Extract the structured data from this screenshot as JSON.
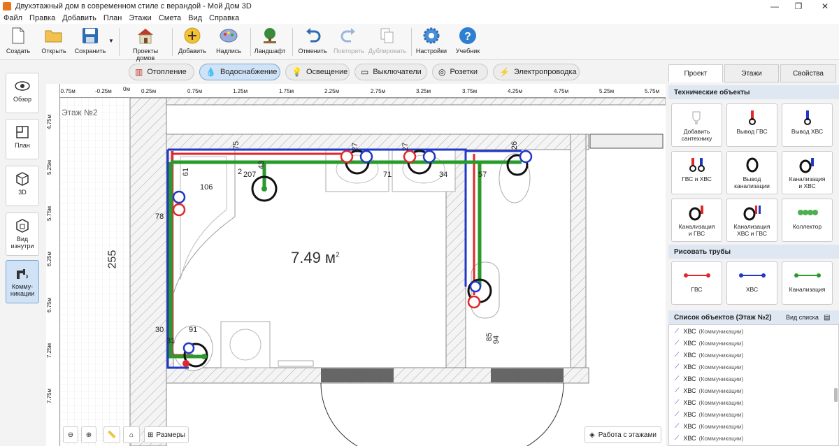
{
  "window": {
    "title": "Двухэтажный дом в современном стиле с верандой - Мой Дом 3D"
  },
  "menu": [
    "Файл",
    "Правка",
    "Добавить",
    "План",
    "Этажи",
    "Смета",
    "Вид",
    "Справка"
  ],
  "toolbar": {
    "create": "Создать",
    "open": "Открыть",
    "save": "Сохранить",
    "projects": "Проекты домов",
    "add": "Добавить",
    "label": "Надпись",
    "landscape": "Ландшафт",
    "undo": "Отменить",
    "redo": "Повторить",
    "duplicate": "Дублировать",
    "settings": "Настройки",
    "tutorial": "Учебник"
  },
  "leftbar": {
    "overview": "Обзор",
    "plan": "План",
    "view3d": "3D",
    "inside_1": "Вид",
    "inside_2": "изнутри",
    "comm_1": "Комму-",
    "comm_2": "никации"
  },
  "layer_tabs": [
    "Отопление",
    "Водоснабжение",
    "Освещение",
    "Выключатели",
    "Розетки",
    "Электропроводка"
  ],
  "ruler": {
    "h_labels": [
      "-0.75м",
      "-0.25м",
      "0м",
      "0.25м",
      "0.75м",
      "1.25м",
      "1.75м",
      "2.25м",
      "2.75м",
      "3.25м",
      "3.75м",
      "4.25м",
      "4.75м",
      "5.25м",
      "5.75м"
    ],
    "v_labels": [
      "4.75м",
      "5.25м",
      "5.75м",
      "6.25м",
      "6.75м",
      "7.25м",
      "7.75м"
    ]
  },
  "plan": {
    "floor_label": "Этаж №2",
    "room_area": "7.49 м",
    "room_area_sup": "2",
    "side_dim": "255",
    "dims": [
      "75",
      "27",
      "27",
      "26",
      "61",
      "2",
      "207",
      "43",
      "71",
      "34",
      "57",
      "106",
      "78",
      "30",
      "91",
      "31",
      "85",
      "94"
    ]
  },
  "bottom": {
    "sizes": "Размеры",
    "floors_work": "Работа с этажами"
  },
  "right_panel": {
    "tabs": [
      "Проект",
      "Этажи",
      "Свойства"
    ],
    "tech_title": "Технические объекты",
    "objects": [
      {
        "l1": "Добавить",
        "l2": "сантехнику"
      },
      {
        "l1": "Вывод ГВС",
        "l2": ""
      },
      {
        "l1": "Вывод ХВС",
        "l2": ""
      },
      {
        "l1": "ГВС и ХВС",
        "l2": ""
      },
      {
        "l1": "Вывод",
        "l2": "канализации"
      },
      {
        "l1": "Канализация",
        "l2": "и ХВС"
      },
      {
        "l1": "Канализация",
        "l2": "и ГВС"
      },
      {
        "l1": "Канализация",
        "l2": "ХВС и ГВС"
      },
      {
        "l1": "Коллектор",
        "l2": ""
      }
    ],
    "pipes_title": "Рисовать трубы",
    "pipes": [
      "ГВС",
      "ХВС",
      "Канализация"
    ],
    "list_title": "Список объектов (Этаж №2)",
    "list_view": "Вид списка",
    "list_items": [
      {
        "name": "ХВС",
        "type": "(Коммуникации)"
      },
      {
        "name": "ХВС",
        "type": "(Коммуникации)"
      },
      {
        "name": "ХВС",
        "type": "(Коммуникации)"
      },
      {
        "name": "ХВС",
        "type": "(Коммуникации)"
      },
      {
        "name": "ХВС",
        "type": "(Коммуникации)"
      },
      {
        "name": "ХВС",
        "type": "(Коммуникации)"
      },
      {
        "name": "ХВС",
        "type": "(Коммуникации)"
      },
      {
        "name": "ХВС",
        "type": "(Коммуникации)"
      },
      {
        "name": "ХВС",
        "type": "(Коммуникации)"
      },
      {
        "name": "ХВС",
        "type": "(Коммуникации)"
      }
    ]
  },
  "colors": {
    "hot": "#e0282b",
    "cold": "#2038c8",
    "sewer": "#2a9a2a",
    "accent": "#cfe2f6"
  }
}
